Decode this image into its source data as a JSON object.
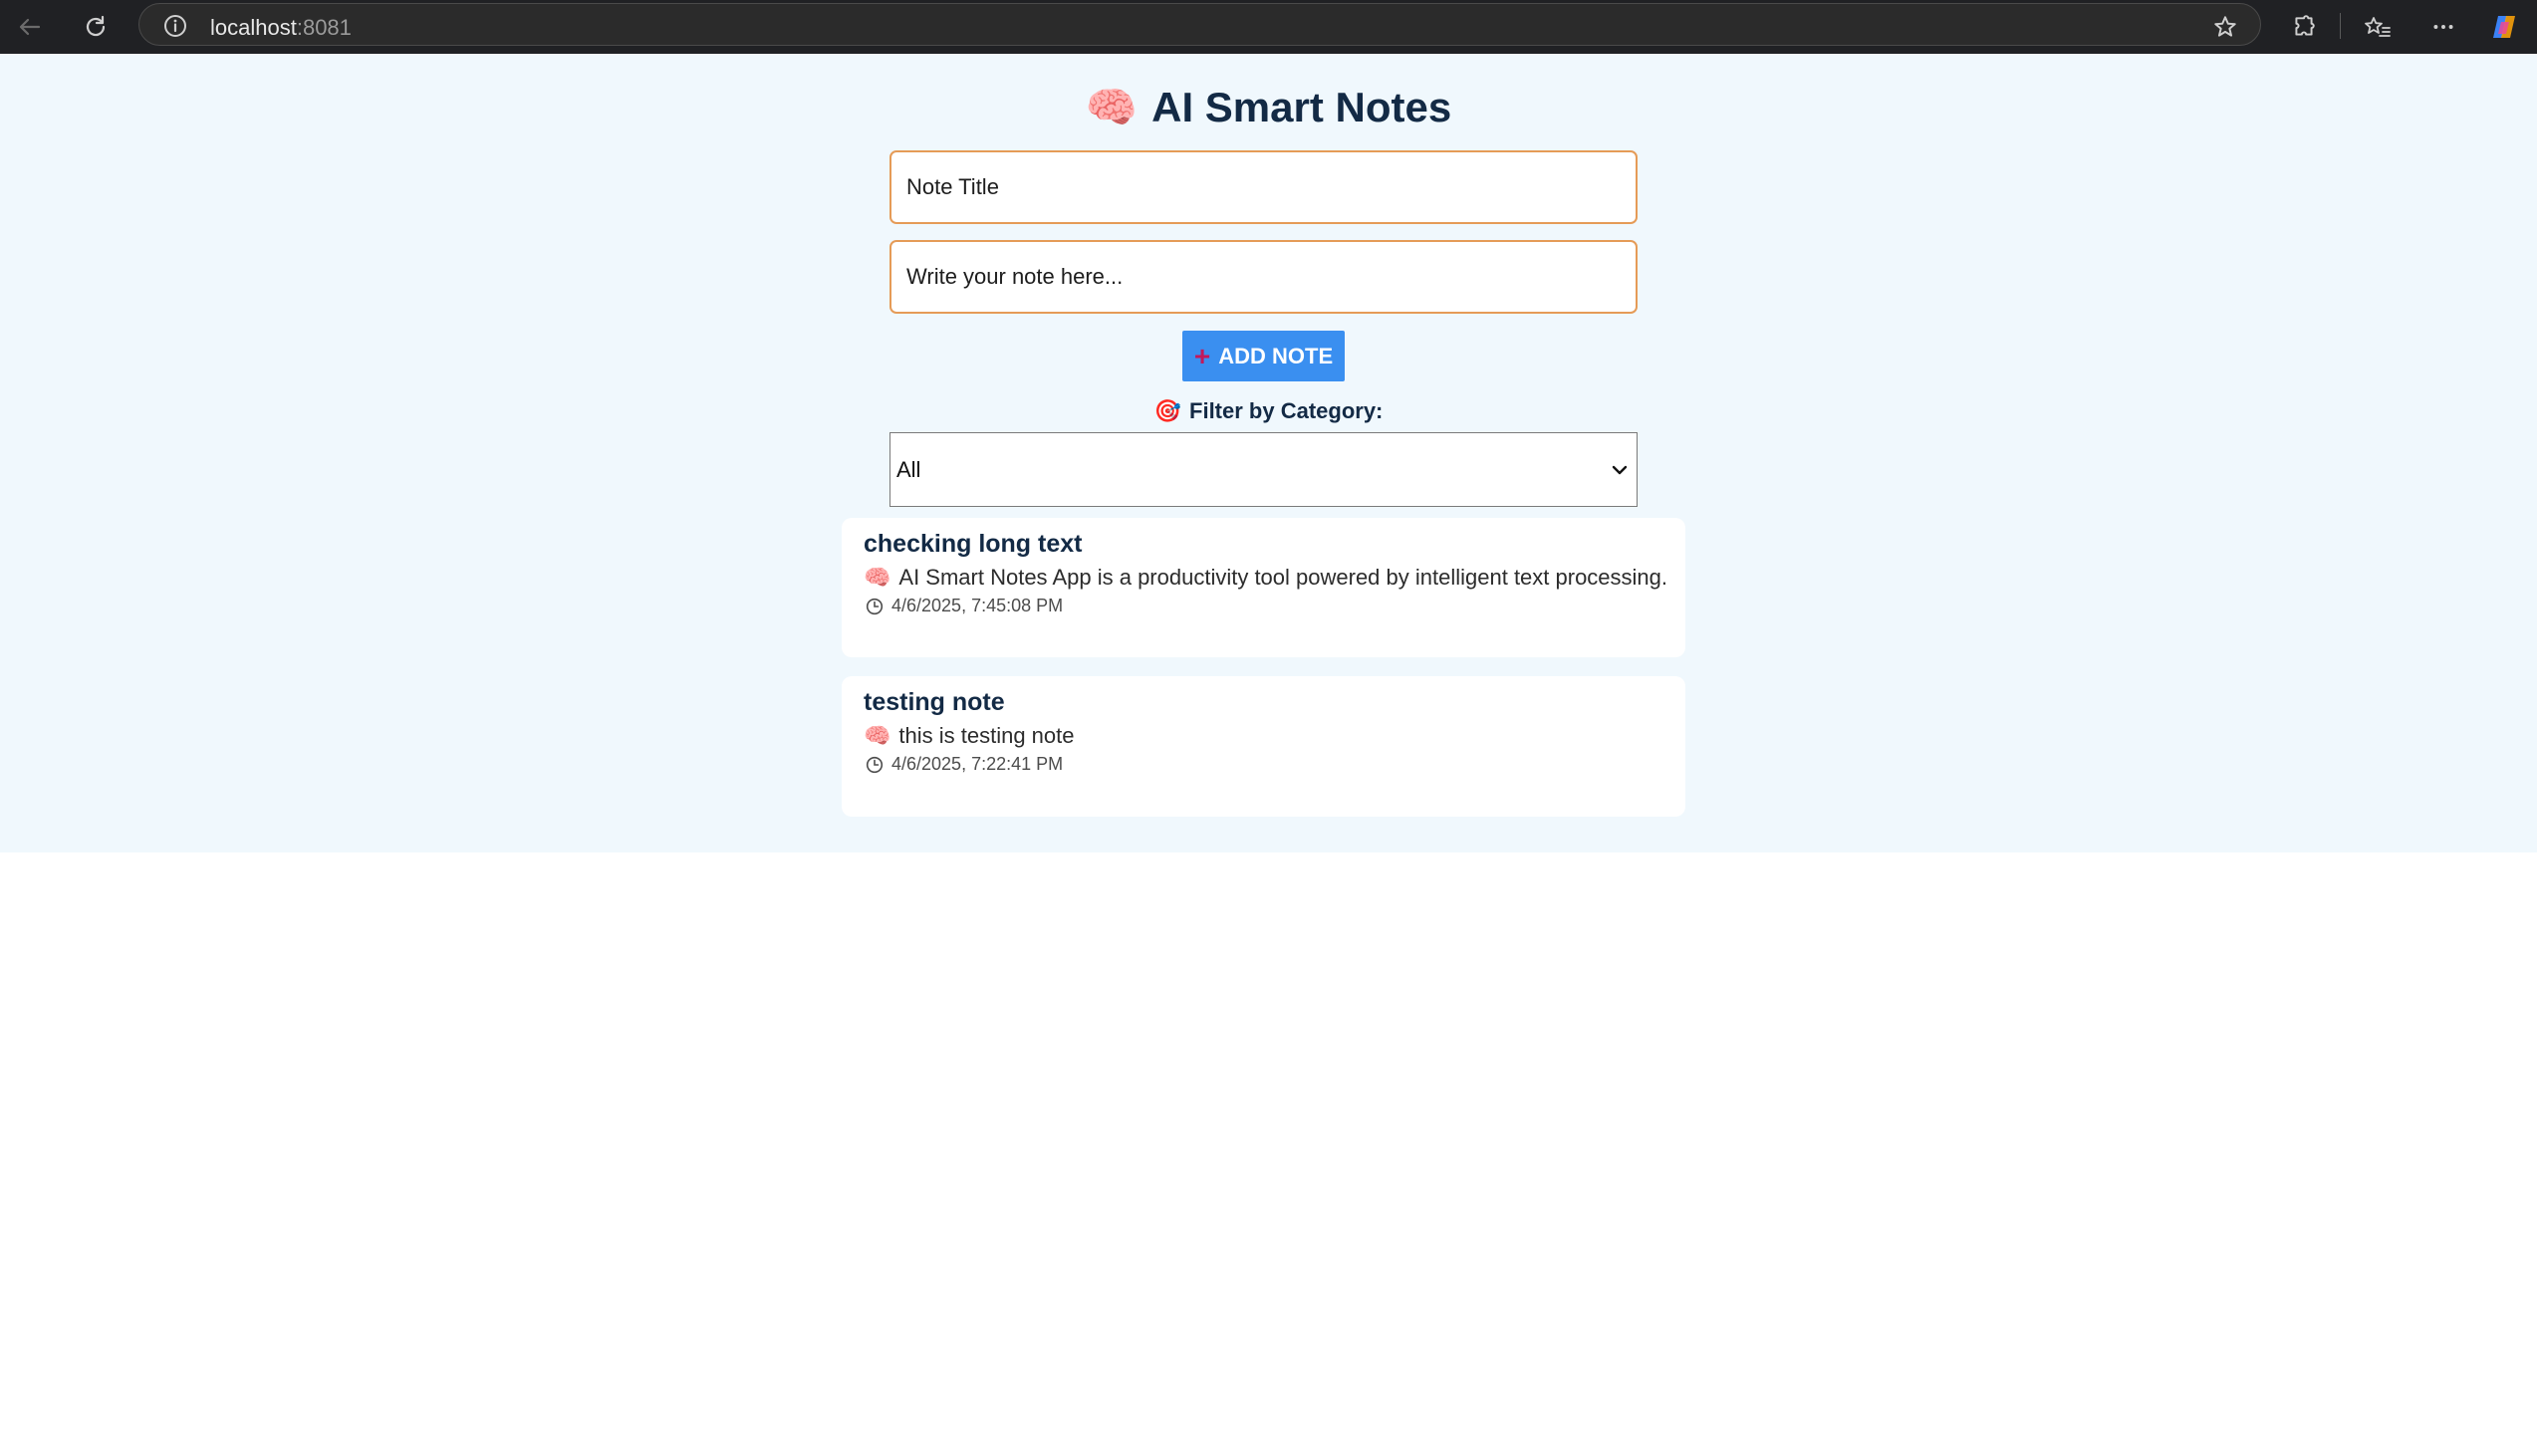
{
  "browser": {
    "url_host": "localhost",
    "url_port": ":8081"
  },
  "app": {
    "title": "AI Smart Notes",
    "title_emoji": "🧠"
  },
  "form": {
    "title_placeholder": "Note Title",
    "body_placeholder": "Write your note here...",
    "add_label": "ADD NOTE",
    "add_icon": "+"
  },
  "filter": {
    "label": "Filter by Category:",
    "label_icon": "🎯",
    "selected": "All"
  },
  "notes": [
    {
      "title": "checking long text",
      "body": "AI Smart Notes App is a productivity tool powered by intelligent text processing.",
      "body_emoji": "🧠",
      "timestamp": "4/6/2025, 7:45:08 PM"
    },
    {
      "title": "testing note",
      "body": "this is testing note",
      "body_emoji": "🧠",
      "timestamp": "4/6/2025, 7:22:41 PM"
    }
  ]
}
